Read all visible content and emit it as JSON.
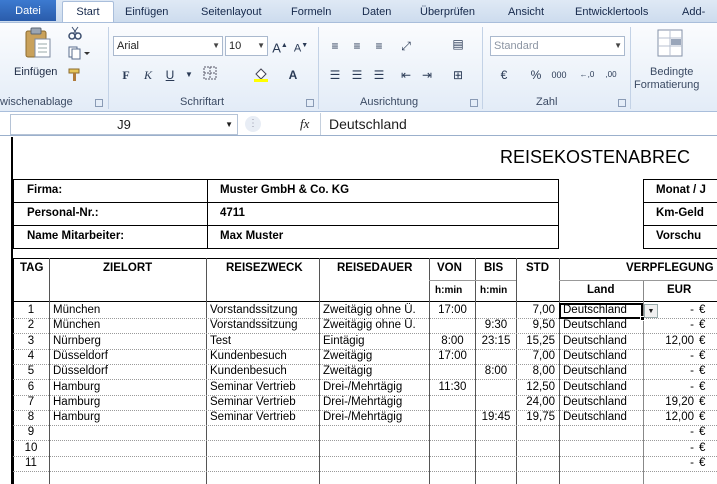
{
  "ribbon": {
    "tabs": [
      "Datei",
      "Start",
      "Einfügen",
      "Seitenlayout",
      "Formeln",
      "Daten",
      "Überprüfen",
      "Ansicht",
      "Entwicklertools",
      "Add-"
    ],
    "paste_label": "Einfügen",
    "groups": [
      "wischenablage",
      "Schriftart",
      "Ausrichtung",
      "Zahl"
    ],
    "font_name": "Arial",
    "font_size": "10",
    "number_format": "Standard",
    "cond_format": [
      "Bedingte",
      "Formatierung"
    ]
  },
  "formula_bar": {
    "name_box": "J9",
    "fx": "fx",
    "content": "Deutschland"
  },
  "sheet": {
    "title": "REISEKOSTENABREC",
    "info_left": [
      {
        "label": "Firma:",
        "value": "Muster GmbH & Co. KG"
      },
      {
        "label": "Personal-Nr.:",
        "value": "4711"
      },
      {
        "label": "Name Mitarbeiter:",
        "value": "Max Muster"
      }
    ],
    "info_right": [
      "Monat / J",
      "Km-Geld",
      "Vorschu"
    ],
    "headers": {
      "tag": "TAG",
      "zielort": "ZIELORT",
      "zweck": "REISEZWECK",
      "dauer": "REISEDAUER",
      "von": "VON",
      "bis": "BIS",
      "std": "STD",
      "verpflegung": "VERPFLEGUNG",
      "hmin1": "h:min",
      "hmin2": "h:min",
      "land": "Land",
      "eur": "EUR"
    },
    "rows": [
      {
        "tag": "1",
        "ort": "München",
        "zweck": "Vorstandssitzung",
        "dauer": "Zweitägig ohne Ü.",
        "von": "17:00",
        "bis": "",
        "std": "7,00",
        "land": "Deutschland",
        "eur": "-",
        "cur": "€"
      },
      {
        "tag": "2",
        "ort": "München",
        "zweck": "Vorstandssitzung",
        "dauer": "Zweitägig ohne Ü.",
        "von": "",
        "bis": "9:30",
        "std": "9,50",
        "land": "Deutschland",
        "eur": "-",
        "cur": "€"
      },
      {
        "tag": "3",
        "ort": "Nürnberg",
        "zweck": "Test",
        "dauer": "Eintägig",
        "von": "8:00",
        "bis": "23:15",
        "std": "15,25",
        "land": "Deutschland",
        "eur": "12,00",
        "cur": "€"
      },
      {
        "tag": "4",
        "ort": "Düsseldorf",
        "zweck": "Kundenbesuch",
        "dauer": "Zweitägig",
        "von": "17:00",
        "bis": "",
        "std": "7,00",
        "land": "Deutschland",
        "eur": "-",
        "cur": "€"
      },
      {
        "tag": "5",
        "ort": "Düsseldorf",
        "zweck": "Kundenbesuch",
        "dauer": "Zweitägig",
        "von": "",
        "bis": "8:00",
        "std": "8,00",
        "land": "Deutschland",
        "eur": "-",
        "cur": "€"
      },
      {
        "tag": "6",
        "ort": "Hamburg",
        "zweck": "Seminar Vertrieb",
        "dauer": "Drei-/Mehrtägig",
        "von": "11:30",
        "bis": "",
        "std": "12,50",
        "land": "Deutschland",
        "eur": "-",
        "cur": "€"
      },
      {
        "tag": "7",
        "ort": "Hamburg",
        "zweck": "Seminar Vertrieb",
        "dauer": "Drei-/Mehrtägig",
        "von": "",
        "bis": "",
        "std": "24,00",
        "land": "Deutschland",
        "eur": "19,20",
        "cur": "€"
      },
      {
        "tag": "8",
        "ort": "Hamburg",
        "zweck": "Seminar Vertrieb",
        "dauer": "Drei-/Mehrtägig",
        "von": "",
        "bis": "19:45",
        "std": "19,75",
        "land": "Deutschland",
        "eur": "12,00",
        "cur": "€"
      },
      {
        "tag": "9",
        "ort": "",
        "zweck": "",
        "dauer": "",
        "von": "",
        "bis": "",
        "std": "",
        "land": "",
        "eur": "-",
        "cur": "€"
      },
      {
        "tag": "10",
        "ort": "",
        "zweck": "",
        "dauer": "",
        "von": "",
        "bis": "",
        "std": "",
        "land": "",
        "eur": "-",
        "cur": "€"
      },
      {
        "tag": "11",
        "ort": "",
        "zweck": "",
        "dauer": "",
        "von": "",
        "bis": "",
        "std": "",
        "land": "",
        "eur": "-",
        "cur": "€"
      }
    ]
  }
}
